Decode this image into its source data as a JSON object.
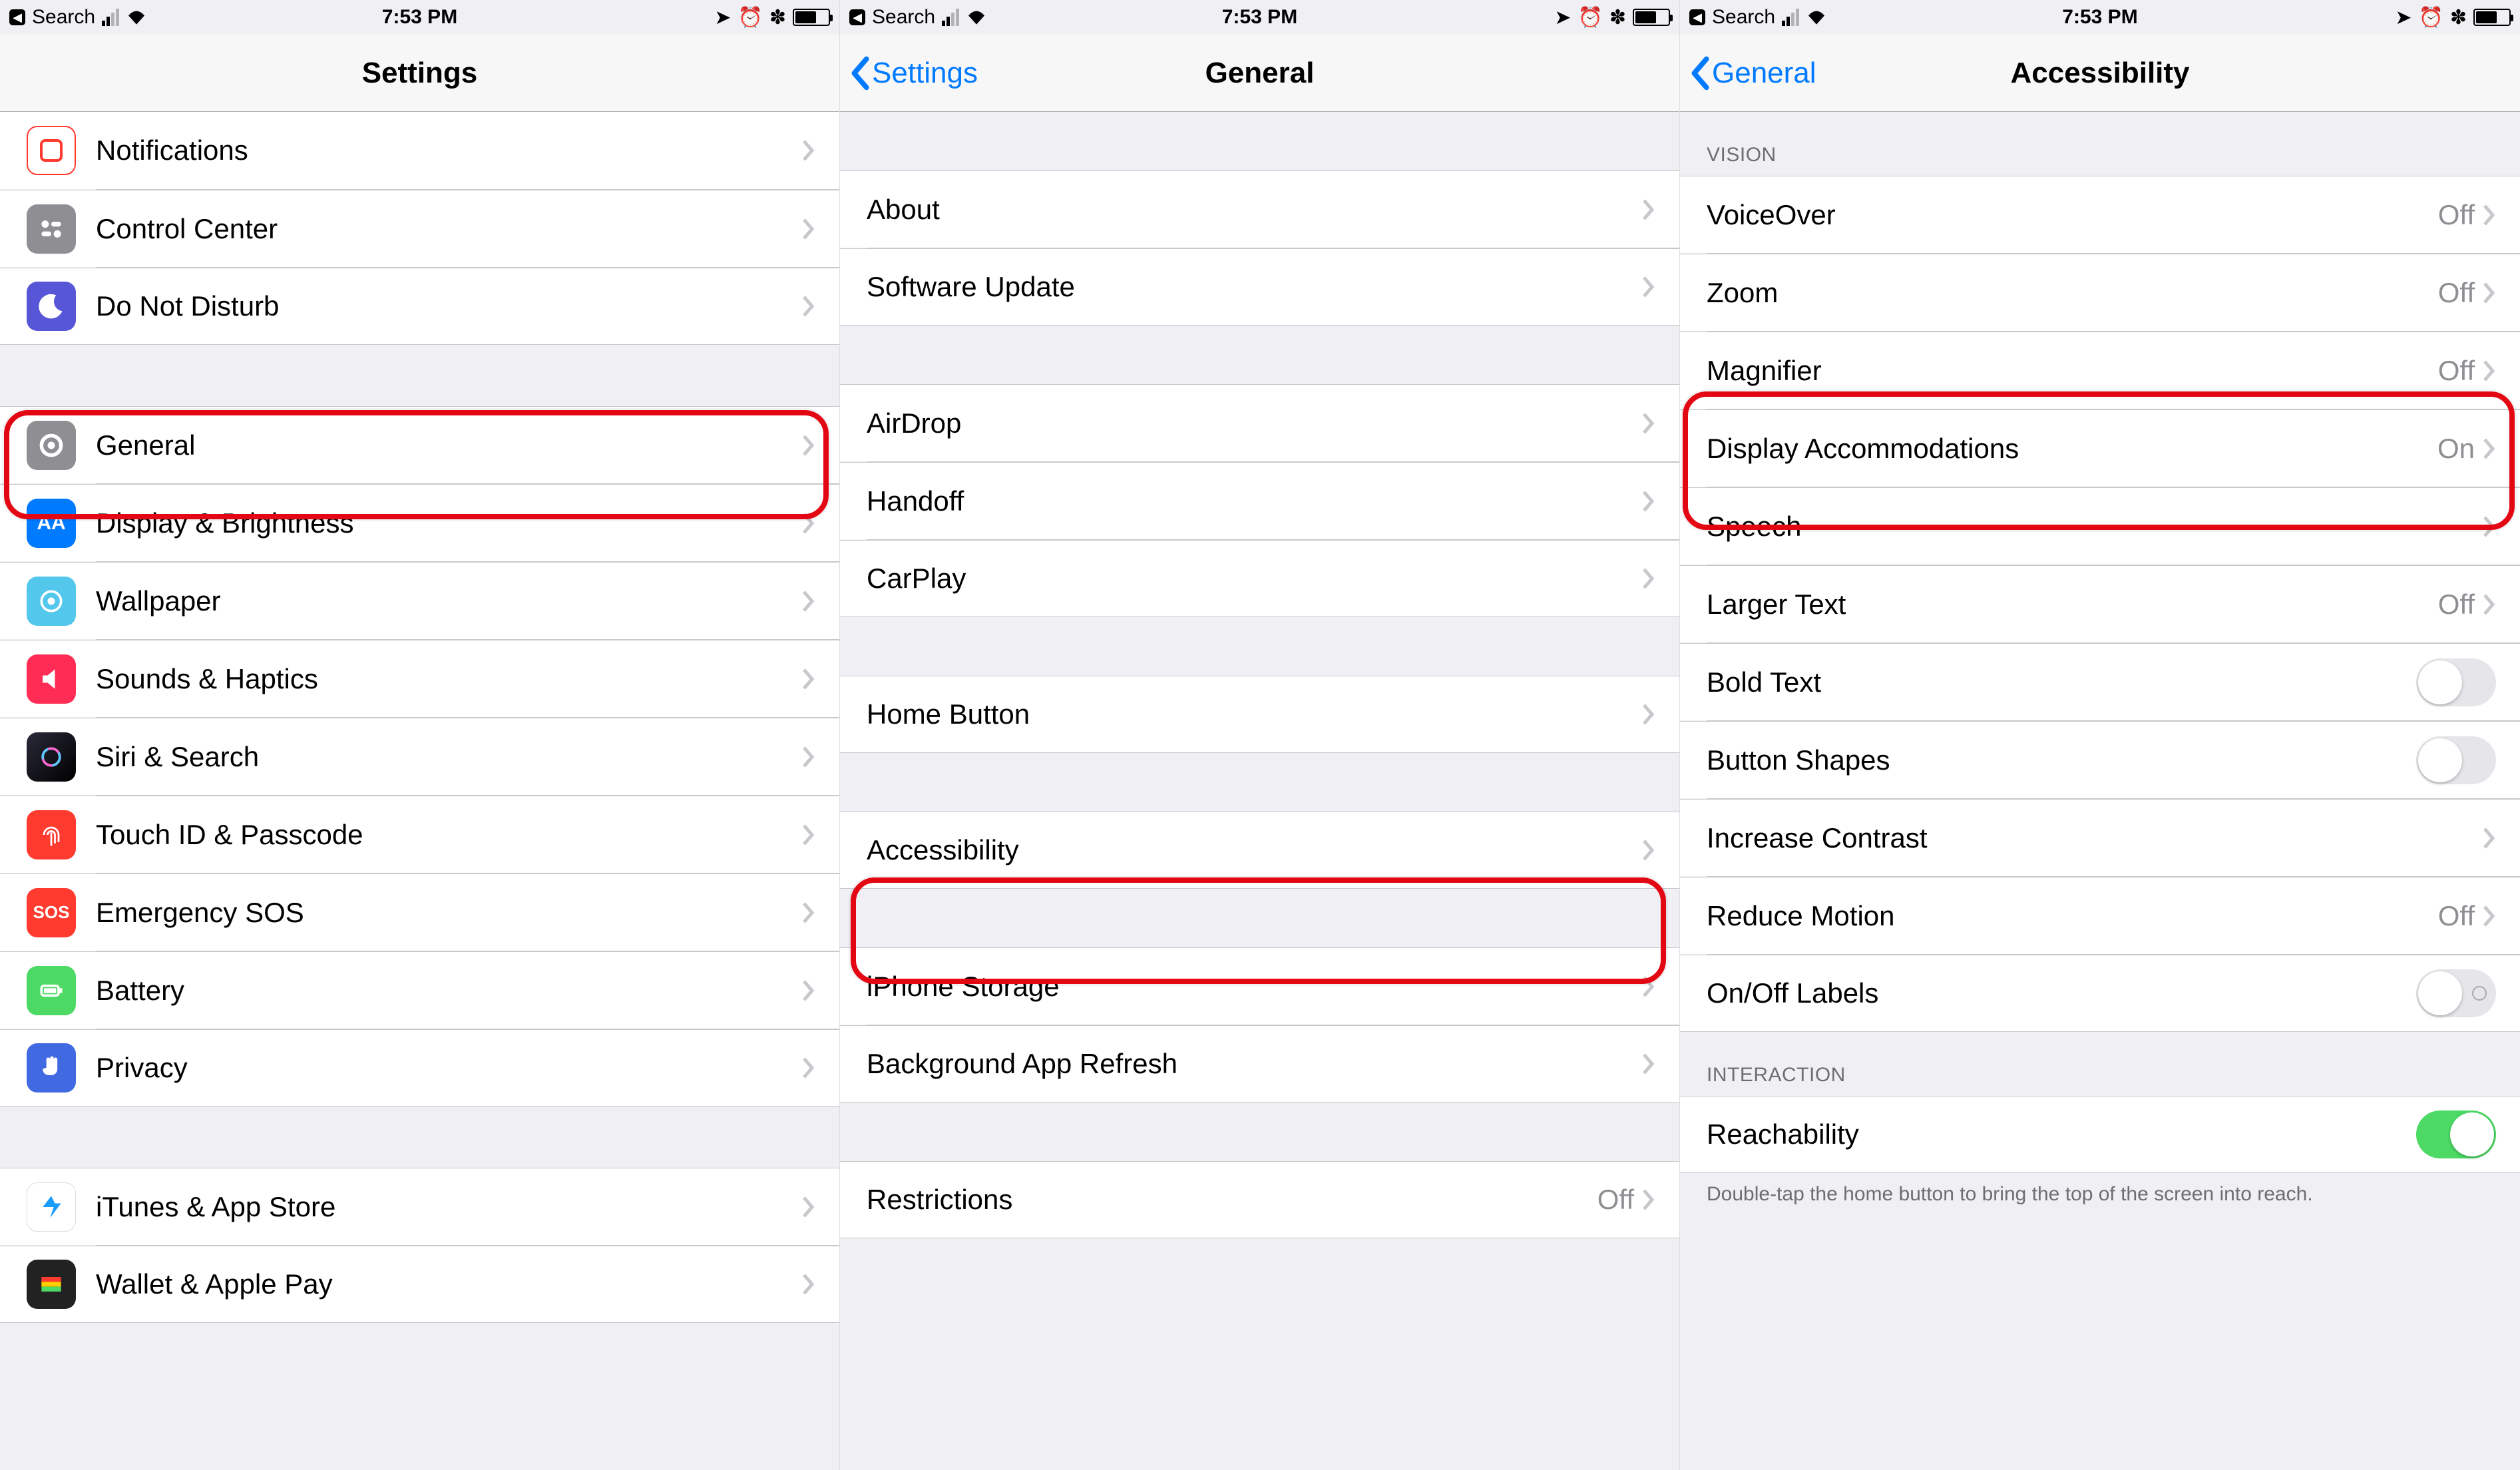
{
  "status": {
    "back_app_label": "Search",
    "time": "7:53 PM"
  },
  "screen1": {
    "nav_title": "Settings",
    "rows": {
      "notifications": "Notifications",
      "control_center": "Control Center",
      "dnd": "Do Not Disturb",
      "general": "General",
      "display": "Display & Brightness",
      "wallpaper": "Wallpaper",
      "sounds": "Sounds & Haptics",
      "siri": "Siri & Search",
      "touchid": "Touch ID & Passcode",
      "sos": "Emergency SOS",
      "battery": "Battery",
      "privacy": "Privacy",
      "itunes": "iTunes & App Store",
      "wallet": "Wallet & Apple Pay"
    }
  },
  "screen2": {
    "nav_title": "General",
    "nav_back": "Settings",
    "rows": {
      "about": "About",
      "software_update": "Software Update",
      "airdrop": "AirDrop",
      "handoff": "Handoff",
      "carplay": "CarPlay",
      "home_button": "Home Button",
      "accessibility": "Accessibility",
      "iphone_storage": "iPhone Storage",
      "bg_refresh": "Background App Refresh",
      "restrictions": "Restrictions",
      "restrictions_value": "Off"
    }
  },
  "screen3": {
    "nav_title": "Accessibility",
    "nav_back": "General",
    "section_vision": "VISION",
    "section_interaction": "INTERACTION",
    "rows": {
      "voiceover": "VoiceOver",
      "voiceover_value": "Off",
      "zoom": "Zoom",
      "zoom_value": "Off",
      "magnifier": "Magnifier",
      "magnifier_value": "Off",
      "display_accom": "Display Accommodations",
      "display_accom_value": "On",
      "speech": "Speech",
      "larger_text": "Larger Text",
      "larger_text_value": "Off",
      "bold_text": "Bold Text",
      "button_shapes": "Button Shapes",
      "increase_contrast": "Increase Contrast",
      "reduce_motion": "Reduce Motion",
      "reduce_motion_value": "Off",
      "onoff_labels": "On/Off Labels",
      "reachability": "Reachability",
      "reachability_footer": "Double-tap the home button to bring the top of the screen into reach."
    }
  }
}
